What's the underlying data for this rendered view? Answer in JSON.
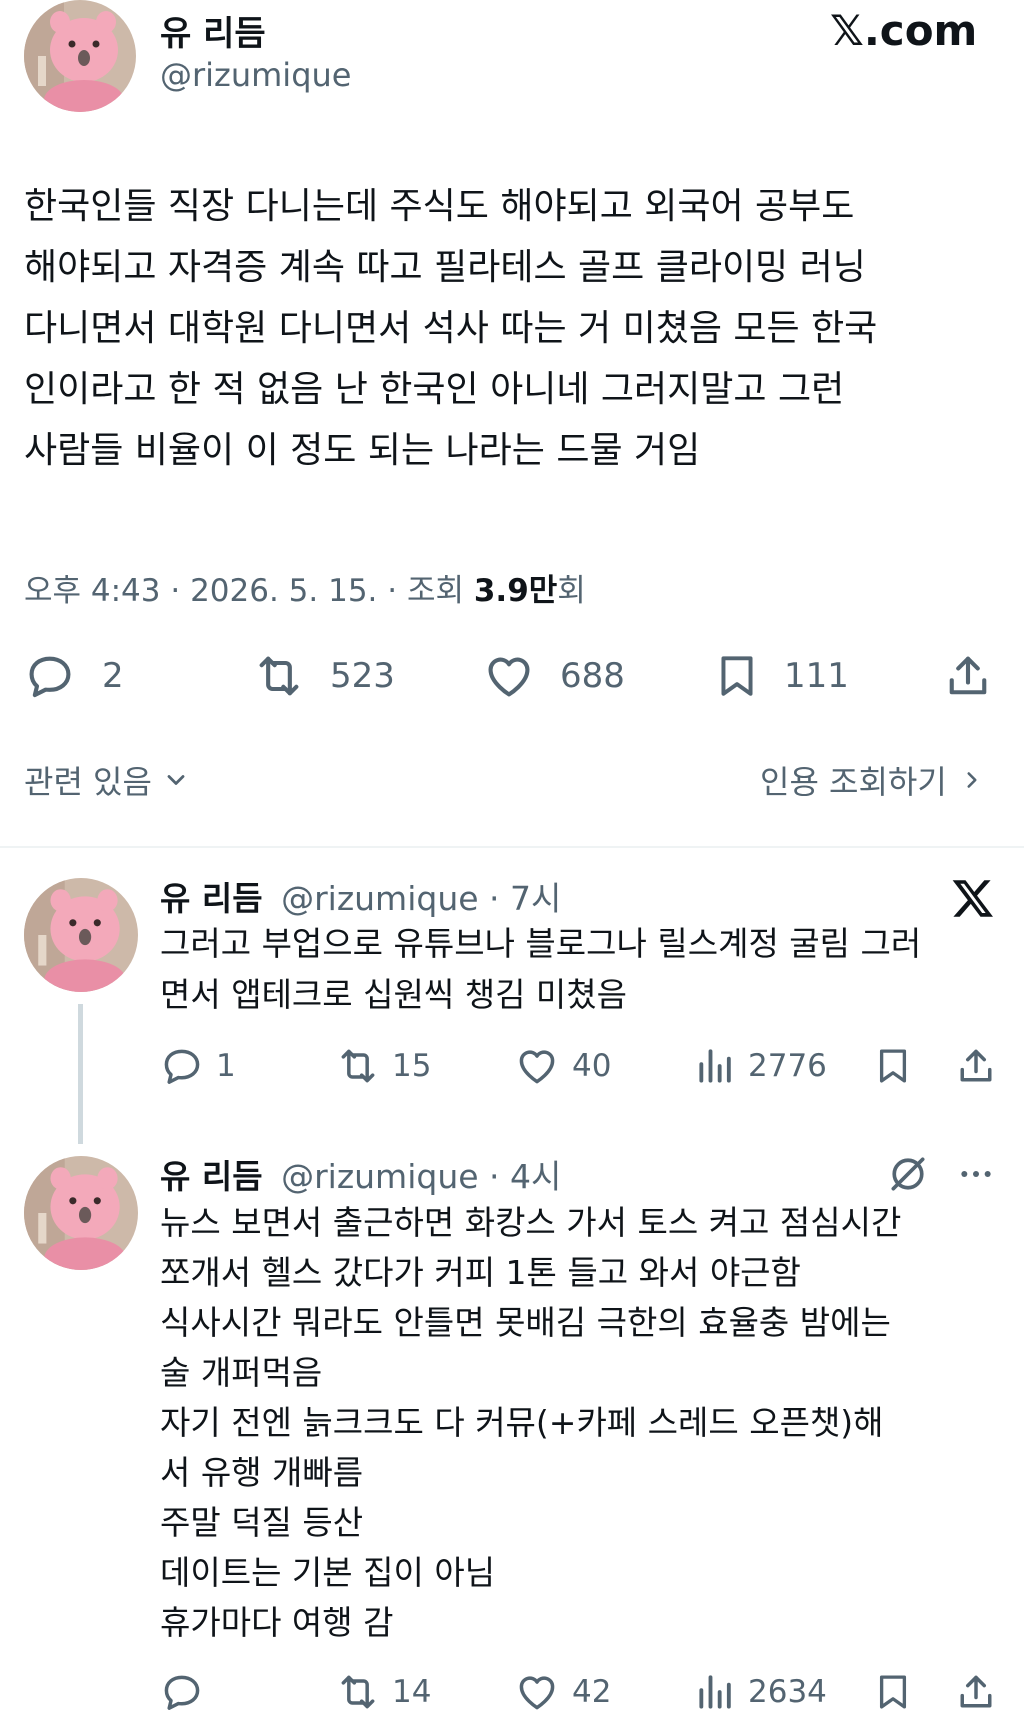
{
  "main_tweet": {
    "author_name": "유 리듬",
    "author_handle": "@rizumique",
    "brand": "𝕏.com",
    "text": "한국인들 직장 다니는데 주식도 해야되고 외국어 공부도\n해야되고 자격증 계속 따고 필라테스 골프 클라이밍 러닝\n다니면서 대학원 다니면서 석사 따는 거 미쳤음 모든 한국\n인이라고 한 적 없음 난 한국인 아니네 그러지말고 그런\n사람들 비율이 이 정도 되는 나라는 드물 거임",
    "meta_time": "오후 4:43 · 2026. 5. 15. · 조회 ",
    "meta_views": "3.9만",
    "meta_views_suffix": "회",
    "counts": {
      "replies": "2",
      "retweets": "523",
      "likes": "688",
      "bookmarks": "111"
    },
    "related_label": "관련 있음",
    "quotes_label": "인용 조회하기"
  },
  "reply1": {
    "author_name": "유 리듬",
    "author_handle": "@rizumique · 7시",
    "text": "그러고 부업으로 유튜브나 블로그나 릴스계정 굴림 그러\n면서 앱테크로 십원씩 챙김 미쳤음",
    "counts": {
      "replies": "1",
      "retweets": "15",
      "likes": "40",
      "views": "2776"
    }
  },
  "reply2": {
    "author_name": "유 리듬",
    "author_handle": "@rizumique · 4시",
    "text": "뉴스 보면서 출근하면 화캉스 가서 토스 켜고 점심시간\n쪼개서 헬스 갔다가 커피 1톤 들고 와서 야근함\n식사시간 뭐라도 안틀면 못배김 극한의 효율충 밤에는\n술 개퍼먹음\n자기 전엔 늙크크도 다 커뮤(+카페 스레드 오픈챗)해\n서 유행 개빠름\n주말 덕질 등산\n데이트는 기본 집이 아님\n휴가마다 여행 감",
    "counts": {
      "replies": "",
      "retweets": "14",
      "likes": "42",
      "views": "2634"
    }
  },
  "icons": {
    "avatar": "pink-quokka-avatar",
    "reply": "speech-bubble-icon",
    "retweet": "retweet-icon",
    "like": "heart-icon",
    "bookmark": "bookmark-icon",
    "share": "share-icon",
    "views": "bar-chart-icon",
    "x_logo": "x-logo-icon",
    "grok": "grok-icon",
    "more": "more-dots-icon",
    "chevron_down": "chevron-down-icon",
    "chevron_right": "chevron-right-icon"
  },
  "colors": {
    "text": "#0f1419",
    "muted": "#536471",
    "divider": "#eff3f4",
    "avatar_bg": "#c9b8a8",
    "quokka_pink": "#f2a6b8"
  }
}
